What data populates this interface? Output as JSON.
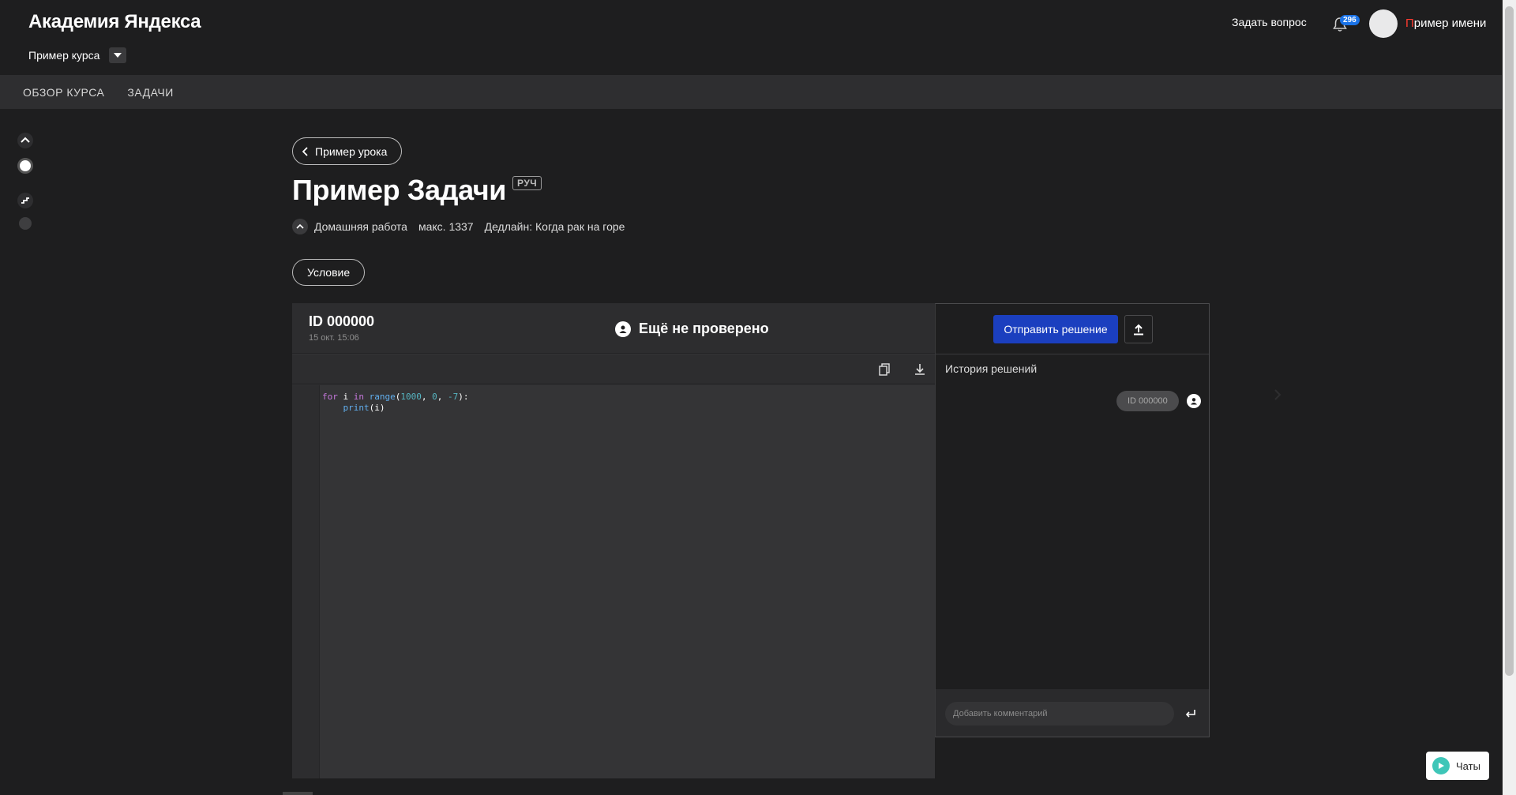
{
  "header": {
    "brand": "Академия Яндекса",
    "course": "Пример курса",
    "ask_question": "Задать вопрос",
    "notifications_count": "296",
    "user_name_first": "П",
    "user_name_rest": "ример имени"
  },
  "nav": {
    "tabs": [
      {
        "label": "ОБЗОР КУРСА"
      },
      {
        "label": "ЗАДАЧИ"
      }
    ]
  },
  "lesson": {
    "back_label": "Пример урока",
    "title": "Пример Задачи",
    "tag": "РУЧ",
    "kind": "Домашняя работа",
    "max_score": "макс. 1337",
    "deadline": "Дедлайн: Когда рак на горе",
    "condition_button": "Условие"
  },
  "solution": {
    "id": "ID 000000",
    "date": "15 окт. 15:06",
    "status": "Ещё не проверено",
    "code_line1": {
      "kw1": "for",
      "var": " i ",
      "kw2": "in",
      "fn": " range",
      "open": "(",
      "n1": "1000",
      "sep1": ", ",
      "n2": "0",
      "sep2": ", ",
      "n3": "-7",
      "close": "):"
    },
    "code_line2": {
      "indent": "    ",
      "fn": "print",
      "args": "(i)"
    }
  },
  "history": {
    "submit_label": "Отправить решение",
    "title": "История решений",
    "items": [
      {
        "label": "ID 000000"
      }
    ],
    "comment_placeholder": "Добавить комментарий"
  },
  "chat": {
    "label": "Чаты"
  },
  "colors": {
    "background": "#1e1e1f",
    "navbar": "#2e2e30",
    "primary_button": "#1b3fbf",
    "badge": "#1a73e8",
    "name_initial": "#ff3b30"
  }
}
